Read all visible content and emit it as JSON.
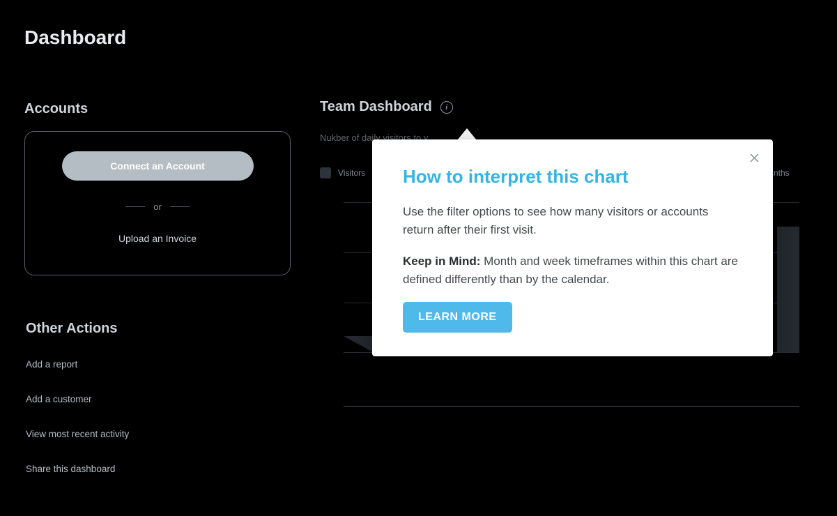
{
  "page_title": "Dashboard",
  "accounts": {
    "section_title": "Accounts",
    "connect_label": "Connect an Account",
    "or_label": "or",
    "upload_label": "Upload an Invoice"
  },
  "other_actions": {
    "section_title": "Other Actions",
    "items": [
      "Add a report",
      "Add a customer",
      "View most recent activity",
      "Share this dashboard"
    ]
  },
  "team_dashboard": {
    "title": "Team Dashboard",
    "subtitle_visible": "Nukber of daily visitors to y",
    "legend_visitors": "Visitors",
    "timeframe_suffix": "nths"
  },
  "popover": {
    "title": "How to interpret this chart",
    "para1": "Use the filter options to see how many visitors or accounts return after their first visit.",
    "para2_bold": "Keep in Mind:",
    "para2_rest": " Month and week timeframes within this chart are defined differently than by the calendar.",
    "learn_more": "LEARN MORE"
  },
  "colors": {
    "accent_blue": "#34b5e5",
    "button_blue": "#4fbaea",
    "pill_grey": "#b4bdc4"
  }
}
